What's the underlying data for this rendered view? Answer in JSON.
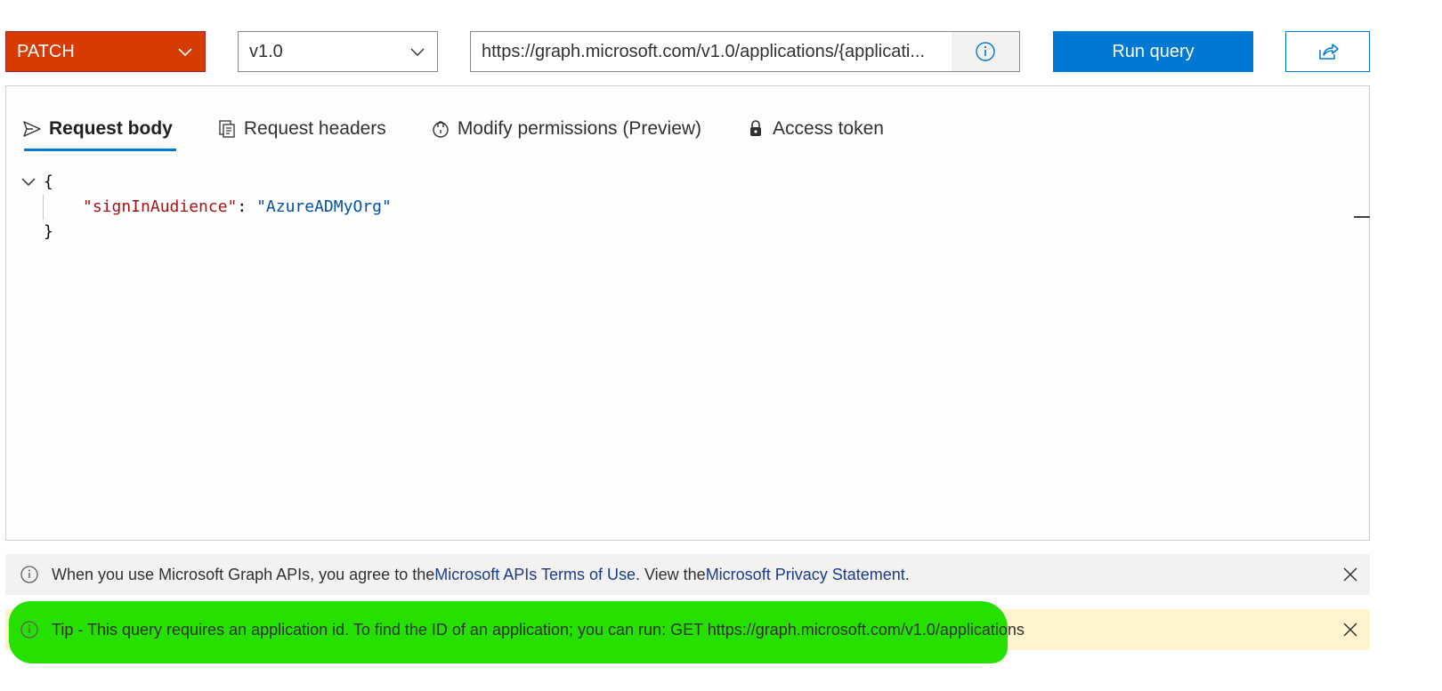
{
  "query": {
    "method": "PATCH",
    "version": "v1.0",
    "url": "https://graph.microsoft.com/v1.0/applications/{applicati...",
    "run_label": "Run query"
  },
  "tabs": [
    {
      "label": "Request body",
      "icon": "send-icon"
    },
    {
      "label": "Request headers",
      "icon": "headers-icon"
    },
    {
      "label": "Modify permissions (Preview)",
      "icon": "permissions-icon"
    },
    {
      "label": "Access token",
      "icon": "lock-icon"
    }
  ],
  "editor": {
    "open_brace": "{",
    "key": "\"signInAudience\"",
    "colon": ": ",
    "value": "\"AzureADMyOrg\"",
    "close_brace": "}"
  },
  "info_bar": {
    "text_1": "When you use Microsoft Graph APIs, you agree to the ",
    "link_terms": "Microsoft APIs Terms of Use",
    "text_2": ". View the ",
    "link_privacy": "Microsoft Privacy Statement",
    "text_3": "."
  },
  "tip_bar": {
    "text": "Tip - This query requires an application id. To find the ID of an application; you can run: GET https://graph.microsoft.com/v1.0/applications"
  },
  "colors": {
    "method_bg": "#d83b01",
    "primary": "#0078d4",
    "tip_bg": "#fff4ce",
    "highlight": "#25e000"
  }
}
